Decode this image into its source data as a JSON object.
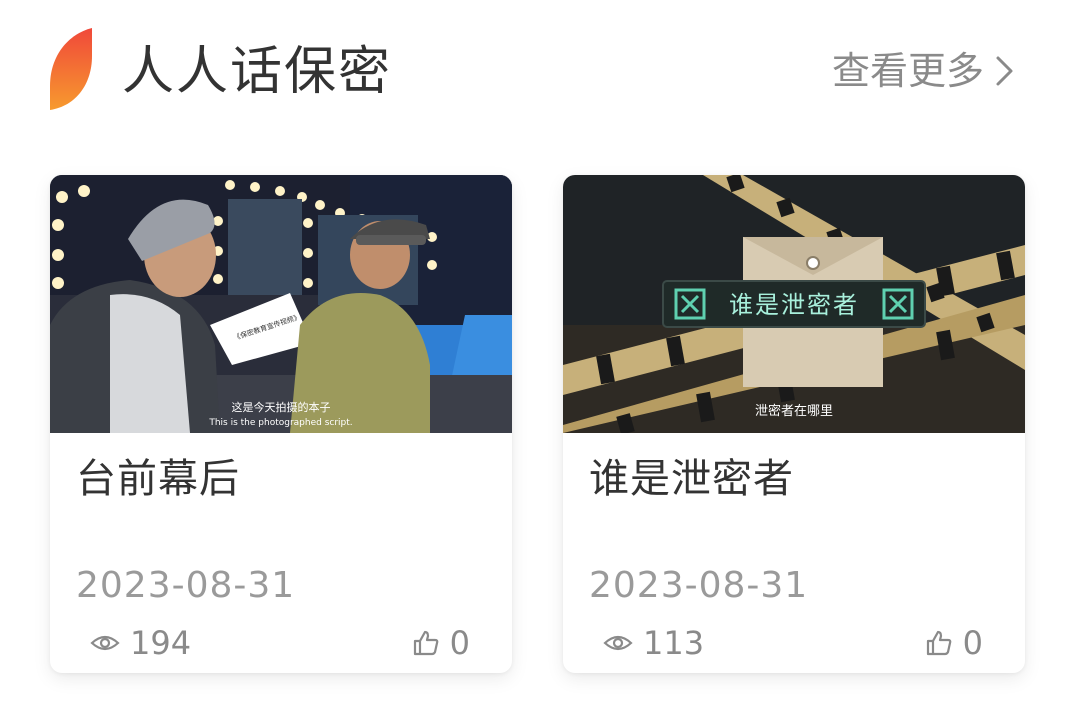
{
  "section": {
    "title": "人人话保密",
    "view_more_label": "查看更多",
    "accent_color": "#f25c2b"
  },
  "cards": [
    {
      "title": "台前幕后",
      "date": "2023-08-31",
      "views": "194",
      "likes": "0",
      "thumbnail": {
        "subtitle_cn": "这是今天拍摄的本子",
        "subtitle_en": "This is the photographed script.",
        "paper_text": "《保密教育宣传视频》"
      }
    },
    {
      "title": "谁是泄密者",
      "date": "2023-08-31",
      "views": "113",
      "likes": "0",
      "thumbnail": {
        "banner_text": "谁是泄密者",
        "subtitle_cn": "泄密者在哪里"
      }
    }
  ],
  "icons": {
    "view": "eye-icon",
    "like": "thumbs-up-icon",
    "more": "chevron-right-icon"
  }
}
